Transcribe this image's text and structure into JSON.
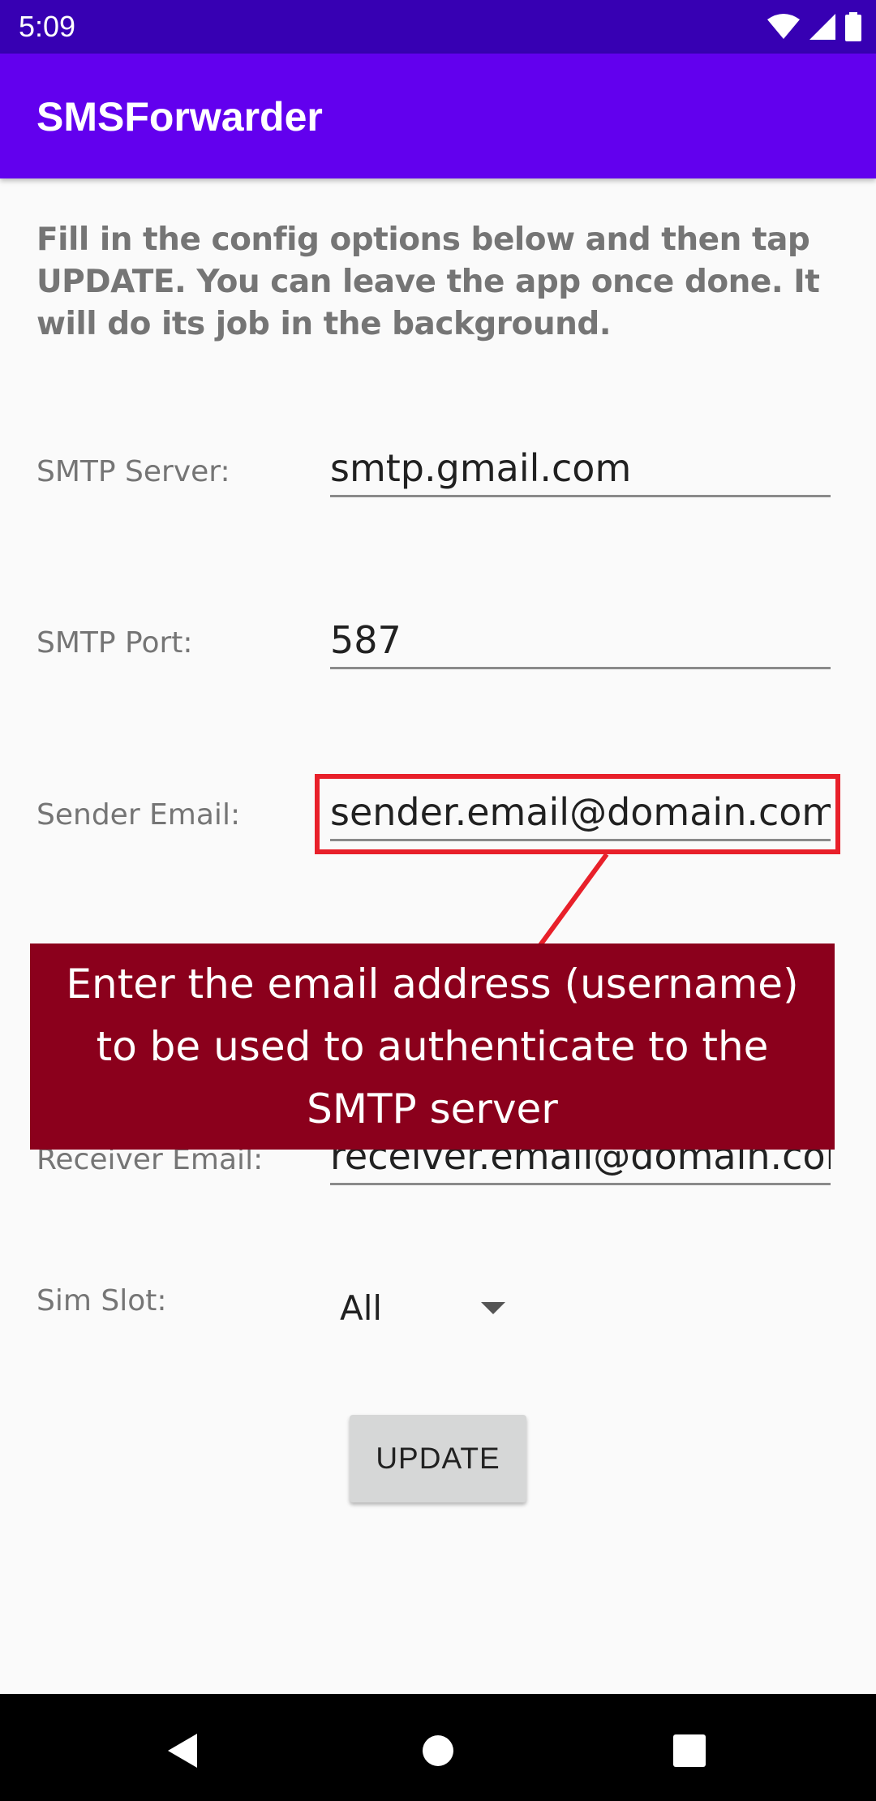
{
  "status_bar": {
    "time": "5:09",
    "icons": [
      "wifi-icon",
      "signal-icon",
      "battery-icon"
    ],
    "background_color": "#3700b3"
  },
  "app_bar": {
    "title": "SMSForwarder",
    "background_color": "#6200ee"
  },
  "intro_text": "Fill in the config options below and then tap UPDATE. You can leave the app once done. It will do its job in the background.",
  "fields": {
    "smtp_server": {
      "label": "SMTP Server:",
      "value": "smtp.gmail.com"
    },
    "smtp_port": {
      "label": "SMTP Port:",
      "value": "587"
    },
    "sender_email": {
      "label": "Sender Email:",
      "value": "sender.email@domain.com"
    },
    "receiver_email": {
      "label": "Receiver Email:",
      "value": "receiver.email@domain.com"
    }
  },
  "sim_slot": {
    "label": "Sim Slot:",
    "selected": "All"
  },
  "update_button": {
    "label": "UPDATE"
  },
  "tooltip": {
    "text": "Enter the email address (username) to be used to authenticate to the SMTP server",
    "background_color": "#8b001c",
    "highlight_color": "#e8202a"
  },
  "nav_bar": {
    "icons": [
      "back-icon",
      "home-icon",
      "recents-icon"
    ]
  }
}
